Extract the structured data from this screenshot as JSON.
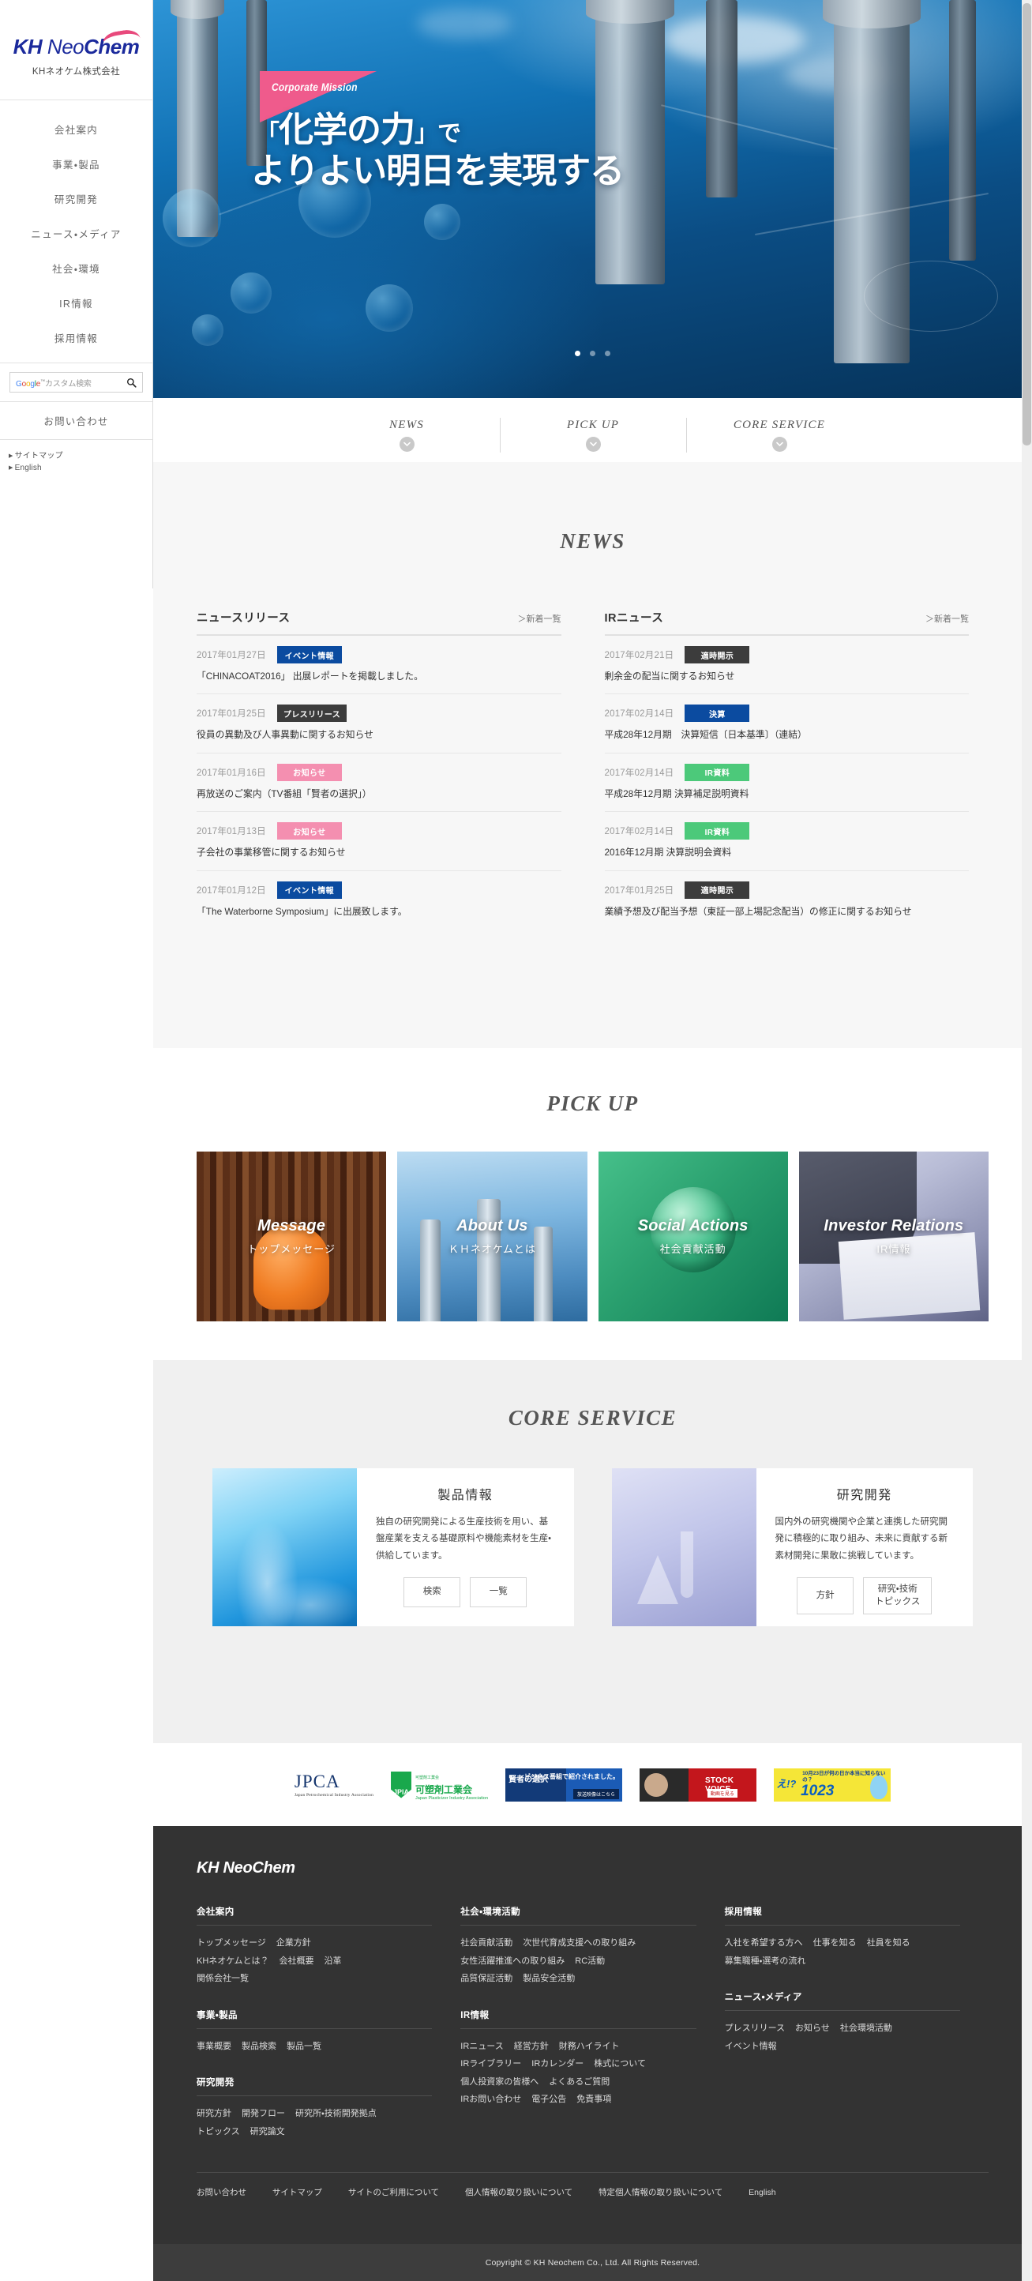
{
  "sidebar": {
    "logo": {
      "kh": "KH",
      "neo": " Neo",
      "chem": "Chem"
    },
    "company": "KHネオケム株式会社",
    "nav": [
      {
        "label": "会社案内"
      },
      {
        "label": "事業・製品"
      },
      {
        "label": "研究開発"
      },
      {
        "label": "ニュース・メディア"
      },
      {
        "label": "社会・環境"
      },
      {
        "label": "IR情報"
      },
      {
        "label": "採用情報"
      }
    ],
    "search_placeholder": "カスタム検索",
    "search_brand": "Google",
    "contact": "お問い合わせ",
    "links": [
      {
        "label": "サイトマップ"
      },
      {
        "label": "English"
      }
    ]
  },
  "hero": {
    "badge": "Corporate Mission",
    "line1_a": "「",
    "line1_b": "化学の力",
    "line1_c": "」で",
    "line2": "よりよい明日を実現する",
    "slide_count": 3,
    "active_slide": 1
  },
  "anchors": [
    {
      "label": "NEWS"
    },
    {
      "label": "PICK UP"
    },
    {
      "label": "CORE SERVICE"
    }
  ],
  "news_section": {
    "title": "NEWS",
    "columns": [
      {
        "heading": "ニュースリリース",
        "more": "＞新着一覧",
        "items": [
          {
            "date": "2017年01月27日",
            "tag": "イベント情報",
            "tag_color": "blue",
            "title": "「CHINACOAT2016」 出展レポートを掲載しました。"
          },
          {
            "date": "2017年01月25日",
            "tag": "プレスリリース",
            "tag_color": "dark",
            "title": "役員の異動及び人事異動に関するお知らせ"
          },
          {
            "date": "2017年01月16日",
            "tag": "お知らせ",
            "tag_color": "pink",
            "title": "再放送のご案内（TV番組「賢者の選択」）"
          },
          {
            "date": "2017年01月13日",
            "tag": "お知らせ",
            "tag_color": "pink",
            "title": "子会社の事業移管に関するお知らせ"
          },
          {
            "date": "2017年01月12日",
            "tag": "イベント情報",
            "tag_color": "blue",
            "title": "「The Waterborne Symposium」に出展致します。"
          }
        ]
      },
      {
        "heading": "IRニュース",
        "more": "＞新着一覧",
        "items": [
          {
            "date": "2017年02月21日",
            "tag": "適時開示",
            "tag_color": "dark",
            "title": "剰余金の配当に関するお知らせ"
          },
          {
            "date": "2017年02月14日",
            "tag": "決算",
            "tag_color": "blue",
            "title": "平成28年12月期　決算短信〔日本基準〕（連結）"
          },
          {
            "date": "2017年02月14日",
            "tag": "IR資料",
            "tag_color": "green",
            "title": "平成28年12月期 決算補足説明資料"
          },
          {
            "date": "2017年02月14日",
            "tag": "IR資料",
            "tag_color": "green",
            "title": "2016年12月期 決算説明会資料"
          },
          {
            "date": "2017年01月25日",
            "tag": "適時開示",
            "tag_color": "dark",
            "title": "業績予想及び配当予想（東証一部上場記念配当）の修正に関するお知らせ"
          }
        ]
      }
    ]
  },
  "pickup": {
    "title": "PICK UP",
    "cards": [
      {
        "en": "Message",
        "jp": "トップメッセージ"
      },
      {
        "en": "About Us",
        "jp": "ＫＨネオケムとは"
      },
      {
        "en": "Social Actions",
        "jp": "社会貢献活動"
      },
      {
        "en": "Investor Relations",
        "jp": "IR情報"
      }
    ]
  },
  "core": {
    "title": "CORE SERVICE",
    "services": [
      {
        "heading": "製品情報",
        "body": "独自の研究開発による生産技術を用い、基盤産業を支える基礎原料や機能素材を生産・供給しています。",
        "buttons": [
          {
            "label": "検索"
          },
          {
            "label": "一覧"
          }
        ]
      },
      {
        "heading": "研究開発",
        "body": "国内外の研究機関や企業と連携した研究開発に積極的に取り組み、未来に貢献する新素材開発に果敢に挑戦しています。",
        "buttons": [
          {
            "label": "方針"
          },
          {
            "label": "研究・技術\nトピックス"
          }
        ]
      }
    ]
  },
  "banners": [
    {
      "name": "jpca",
      "big": "JPCA",
      "small": "Japan Petrochemical Industry Association"
    },
    {
      "name": "jpia",
      "mark": "JPIA",
      "l1": "可塑剤工業会",
      "l2": "可塑剤工業会",
      "l3": "Japan Plasticizer Industry Association"
    },
    {
      "name": "kenja",
      "left": "賢者の選択",
      "right": "ビジネス番組で紹介されました。",
      "button": "放送映像はこちら"
    },
    {
      "name": "stockvoice",
      "title": "STOCK VOICE",
      "button": "動画を見る"
    },
    {
      "name": "1023",
      "top": "10月23日が何の日か本当に知らないの？",
      "eh": "え!?",
      "num": "1023"
    }
  ],
  "footer": {
    "logo": "KH NeoChem",
    "columns": [
      {
        "groups": [
          {
            "heading": "会社案内",
            "links": [
              "トップメッセージ",
              "企業方針",
              "KHネオケムとは？",
              "会社概要",
              "沿革",
              "関係会社一覧"
            ]
          },
          {
            "heading": "事業・製品",
            "links": [
              "事業概要",
              "製品検索",
              "製品一覧"
            ]
          },
          {
            "heading": "研究開発",
            "links": [
              "研究方針",
              "開発フロー",
              "研究所・技術開発拠点",
              "トピックス",
              "研究論文"
            ]
          }
        ]
      },
      {
        "groups": [
          {
            "heading": "社会・環境活動",
            "links": [
              "社会貢献活動",
              "次世代育成支援への取り組み",
              "女性活躍推進への取り組み",
              "RC活動",
              "品質保証活動",
              "製品安全活動"
            ]
          },
          {
            "heading": "IR情報",
            "links": [
              "IRニュース",
              "経営方針",
              "財務ハイライト",
              "IRライブラリー",
              "IRカレンダー",
              "株式について",
              "個人投資家の皆様へ",
              "よくあるご質問",
              "IRお問い合わせ",
              "電子公告",
              "免責事項"
            ]
          }
        ]
      },
      {
        "groups": [
          {
            "heading": "採用情報",
            "links": [
              "入社を希望する方へ",
              "仕事を知る",
              "社員を知る",
              "募集職種・選考の流れ"
            ]
          },
          {
            "heading": "ニュース・メディア",
            "links": [
              "プレスリリース",
              "お知らせ",
              "社会環境活動",
              "イベント情報"
            ]
          }
        ]
      }
    ],
    "bottom_links": [
      "お問い合わせ",
      "サイトマップ",
      "サイトのご利用について",
      "個人情報の取り扱いについて",
      "特定個人情報の取り扱いについて",
      "English"
    ],
    "copyright": "Copyright © KH Neochem Co., Ltd. All Rights Reserved."
  }
}
